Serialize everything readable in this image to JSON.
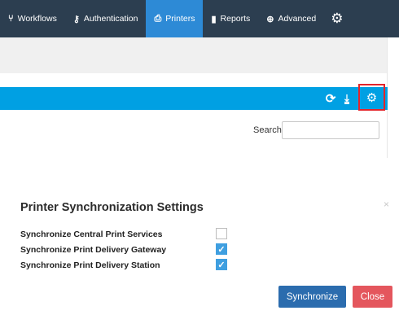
{
  "nav": {
    "items": [
      {
        "label": "Workflows",
        "icon": "branch-icon",
        "glyph": "⑂"
      },
      {
        "label": "Authentication",
        "icon": "key-icon",
        "glyph": "⚷"
      },
      {
        "label": "Printers",
        "icon": "printer-icon",
        "glyph": "⎙"
      },
      {
        "label": "Reports",
        "icon": "bar-chart-icon",
        "glyph": "▮"
      },
      {
        "label": "Advanced",
        "icon": "plus-circle-icon",
        "glyph": "⊕"
      }
    ],
    "active": "Printers",
    "settings_icon": "gear-icon",
    "colors": {
      "bar": "#2c3e50",
      "active": "#2d8ad6"
    }
  },
  "panel": {
    "header_color": "#00a0e3",
    "icons": [
      "refresh-icon",
      "download-icon",
      "gear-icon"
    ],
    "highlight_color": "#e4252b",
    "search": {
      "label": "Search:",
      "value": ""
    }
  },
  "dialog": {
    "title": "Printer Synchronization Settings",
    "close_glyph": "×",
    "options": [
      {
        "label": "Synchronize Central Print Services",
        "checked": false
      },
      {
        "label": "Synchronize Print Delivery Gateway",
        "checked": true
      },
      {
        "label": "Synchronize Print Delivery Station",
        "checked": true
      }
    ],
    "buttons": {
      "synchronize": "Synchronize",
      "close": "Close"
    },
    "colors": {
      "checkbox": "#3f9fe0",
      "synchronize": "#2b6cae",
      "close": "#e4565d"
    }
  }
}
